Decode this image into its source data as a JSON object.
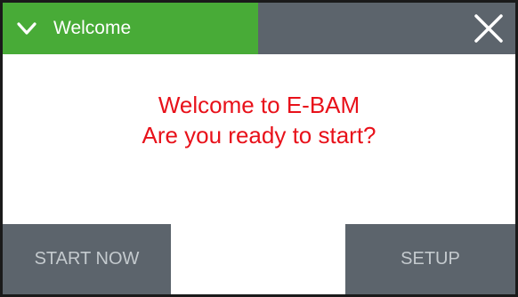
{
  "header": {
    "title": "Welcome",
    "expand_icon": "chevron-down-icon",
    "close_icon": "close-icon"
  },
  "message": {
    "line1": "Welcome to E-BAM",
    "line2": "Are you ready to start?"
  },
  "buttons": {
    "start_label": "START NOW",
    "setup_label": "SETUP"
  },
  "colors": {
    "accent_green": "#48ab37",
    "header_gray": "#5c646c",
    "message_red": "#e8111a",
    "button_text": "#c4cace"
  }
}
